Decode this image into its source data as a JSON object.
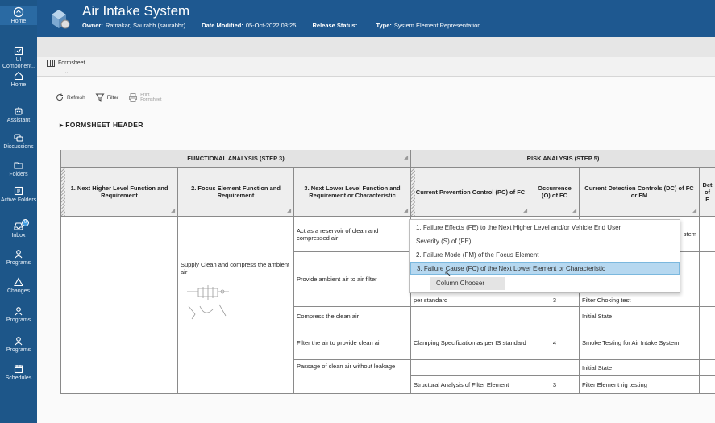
{
  "nav": [
    {
      "label": "Home",
      "icon": "home-circle-icon"
    },
    {
      "label": "UI Component..",
      "icon": "ui-component-icon"
    },
    {
      "label": "Home",
      "icon": "home-icon"
    },
    {
      "label": "Assistant",
      "icon": "assistant-icon"
    },
    {
      "label": "Discussions",
      "icon": "discussions-icon"
    },
    {
      "label": "Folders",
      "icon": "folder-icon"
    },
    {
      "label": "Active Folders",
      "icon": "active-folders-icon"
    },
    {
      "label": "Inbox",
      "icon": "inbox-icon",
      "badge": "0"
    },
    {
      "label": "Programs",
      "icon": "programs-icon"
    },
    {
      "label": "Changes",
      "icon": "changes-icon"
    },
    {
      "label": "Programs",
      "icon": "programs-icon"
    },
    {
      "label": "Programs",
      "icon": "programs-icon"
    },
    {
      "label": "Schedules",
      "icon": "schedules-icon"
    }
  ],
  "header": {
    "title": "Air Intake System",
    "owner_label": "Owner:",
    "owner_value": "Ratnakar, Saurabh (saurabhr)",
    "date_label": "Date Modified:",
    "date_value": "05-Oct-2022 03:25",
    "release_label": "Release Status:",
    "release_value": "",
    "type_label": "Type:",
    "type_value": "System Element Representation"
  },
  "tab": {
    "label": "Formsheet"
  },
  "toolbar": {
    "refresh": "Refresh",
    "filter": "Filter",
    "print_line1": "Print",
    "print_line2": "Formsheet"
  },
  "section": {
    "title": "FORMSHEET HEADER"
  },
  "table": {
    "group1": "FUNCTIONAL ANALYSIS (STEP 3)",
    "group2": "RISK ANALYSIS (STEP 5)",
    "headers": [
      "1. Next Higher Level Function and Requirement",
      "2. Focus Element Function and Requirement",
      "3. Next Lower Level Function and Requirement or Characteristic",
      "Current Prevention Control (PC) of FC",
      "Occurrence (O) of FC",
      "Current Detection Controls (DC) of FC or FM",
      "Det of F"
    ],
    "focus_function": "Supply Clean and compress the ambient air",
    "lower": [
      "Act as a reservoir of clean and compressed air",
      "Provide ambient air to air filter",
      "Compress the clean air",
      "Filter the air to provide clean air",
      "Passage of clean air without leakage"
    ],
    "risk": {
      "partial_stem": "stem",
      "r2_pc": "per standard",
      "r2_occ": "3",
      "r2_dc": "Filter Choking test",
      "r3_state": "Initial State",
      "r4_pc": "Clamping Specification as per IS standard",
      "r4_occ": "4",
      "r4_dc": "Smoke Testing for Air Intake System",
      "r5_state": "Initial State",
      "r5_pc": "Structural Analysis of Filter Element",
      "r5_occ": "3",
      "r5_dc": "Filter Element rig testing"
    }
  },
  "menu": {
    "items": [
      "1. Failure Effects (FE) to the Next Higher Level and/or Vehicle End User",
      "Severity (S) of (FE)",
      "2. Failure Mode (FM) of the Focus Element",
      "3. Failure Cause (FC) of the Next Lower Element or Characteristic"
    ],
    "column_chooser": "Column Chooser"
  }
}
